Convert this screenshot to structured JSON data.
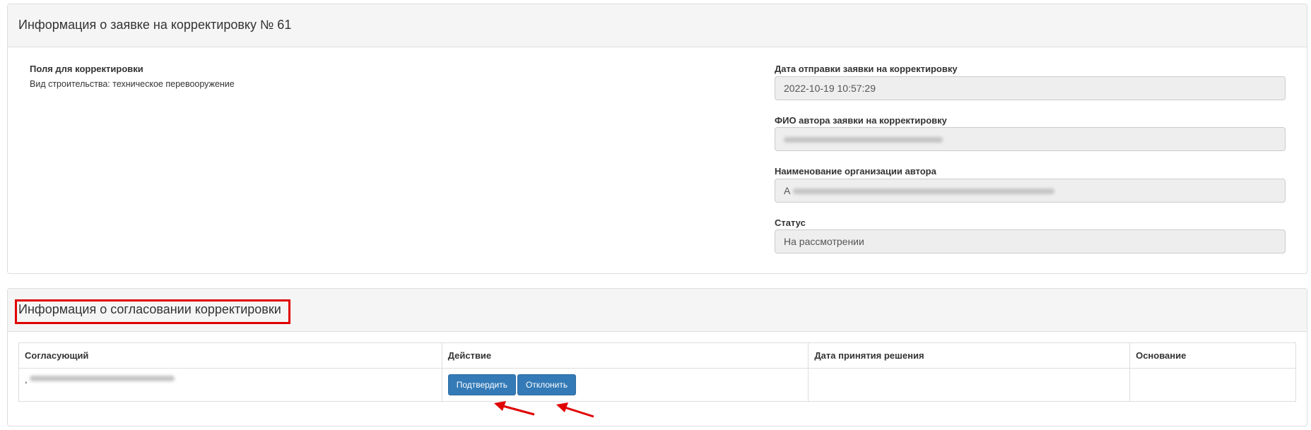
{
  "request_panel": {
    "title": "Информация о заявке на корректировку № 61",
    "fields_label": "Поля для корректировки",
    "fields_value": "Вид строительства: техническое перевооружение",
    "date_label": "Дата отправки заявки на корректировку",
    "date_value": "2022-10-19 10:57:29",
    "author_label": "ФИО автора заявки на корректировку",
    "org_label": "Наименование организации автора",
    "org_prefix": "А",
    "status_label": "Статус",
    "status_value": "На рассмотрении"
  },
  "approval_panel": {
    "title": "Информация о согласовании корректировки",
    "columns": [
      "Согласующий",
      "Действие",
      "Дата принятия решения",
      "Основание"
    ],
    "row": {
      "approver_prefix": ",",
      "confirm_label": "Подтвердить",
      "reject_label": "Отклонить",
      "decision_date": "",
      "reason": ""
    }
  },
  "annotations": {
    "highlight_color": "#e00000",
    "arrow_color": "#e00000"
  }
}
